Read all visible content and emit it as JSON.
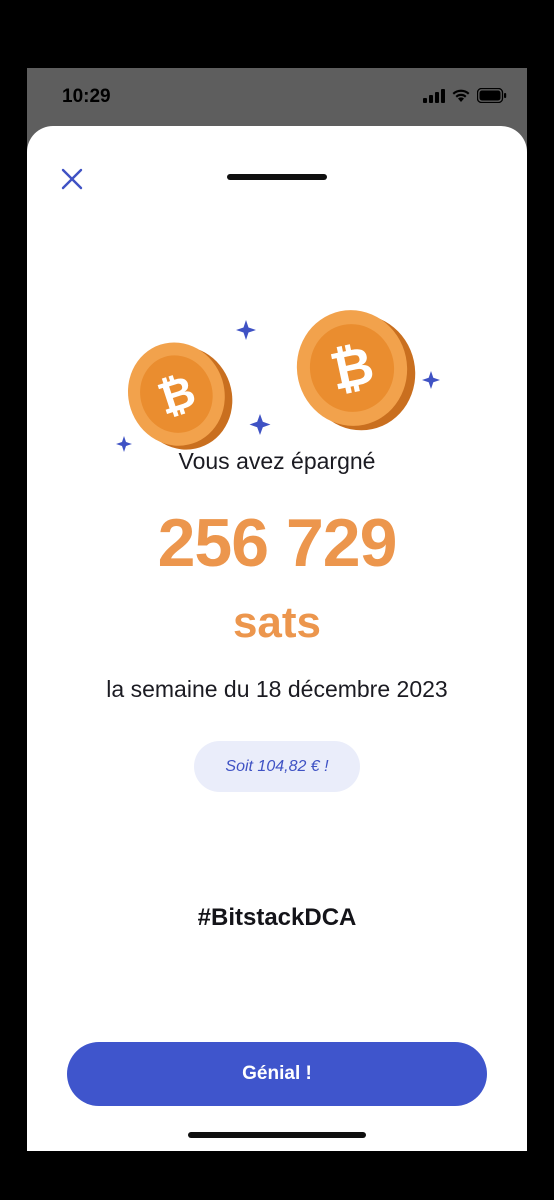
{
  "status_bar": {
    "time": "10:29",
    "icons": [
      "signal-icon",
      "wifi-icon",
      "battery-icon"
    ]
  },
  "sheet": {
    "close_icon": "close-icon",
    "headline": "Vous avez épargné",
    "amount": "256 729",
    "unit": "sats",
    "period": "la semaine du 18 décembre 2023",
    "equivalent": "Soit 104,82 € !",
    "hashtag": "#BitstackDCA",
    "cta_label": "Génial !"
  },
  "colors": {
    "accent_orange": "#ec964d",
    "primary_blue": "#3f55cc",
    "pill_background": "#eaedfa",
    "sparkle_blue": "#3f52c4"
  }
}
